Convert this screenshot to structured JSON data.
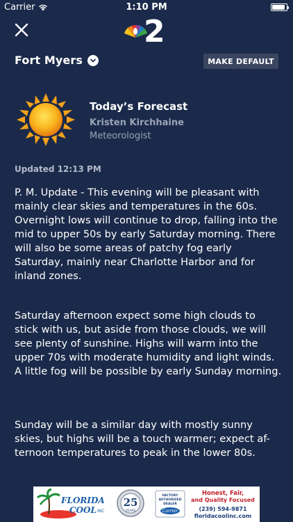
{
  "status_bar": {
    "carrier": "Carrier",
    "time": "1:10 PM"
  },
  "header": {
    "logo_text": "2"
  },
  "location": {
    "name": "Fort Myers",
    "make_default_label": "MAKE DEFAULT"
  },
  "forecast": {
    "title": "Today’s Forecast",
    "author": "Kristen Kirchhaine",
    "role": "Meteorologist",
    "updated": "Updated 12:13 PM",
    "paragraphs": [
      "P. M. Update - This evening will be pleasant with mainly clear skies and temperatures in the 60s. Overnight lows will continue to drop, falling into the mid to upper 50s by early Saturday morning. There will also be some areas of patchy fog early Saturday, mainly near Charlotte Harbor and for inland zones.",
      "Saturday afternoon expect some high clouds to stick with us, but aside from those clouds, we will see plenty of sunshine. Highs will warm into the upper 70s with moderate humidity and light winds. A little fog will be possible by early Sunday morning.",
      "Sunday will be a similar day with mostly sunny skies, but highs will be a touch warmer; expect af-ternoon temperatures to peak in the lower 80s."
    ]
  },
  "ad": {
    "brand_line1": "FLORIDA",
    "brand_line2": "COOL",
    "brand_suffix": "INC",
    "anniversary": "25",
    "anniversary_label": "YEARS",
    "dealer_line1": "FACTORY",
    "dealer_line2": "AUTHORIZED",
    "dealer_line3": "DEALER",
    "dealer_brand": "Carrier",
    "tagline1": "Honest, Fair,",
    "tagline2": "and Quality Focused",
    "phone": "(239) 594-9871",
    "website": "floridacoolinc.com"
  },
  "colors": {
    "background": "#1b2a4a",
    "button_bg": "#3a4560",
    "muted_text": "#9aa3b8",
    "ad_accent": "#c0202a"
  }
}
